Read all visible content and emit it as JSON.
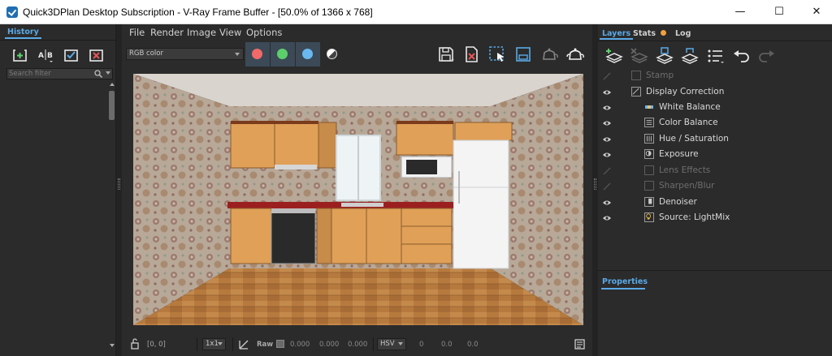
{
  "window": {
    "title": "Quick3DPlan Desktop Subscription - V-Ray Frame Buffer - [50.0% of 1366 x 768]",
    "minimize_label": "—",
    "maximize_label": "☐",
    "close_label": "✕"
  },
  "history": {
    "tab_label": "History",
    "search_placeholder": "Search filter",
    "buttons": [
      "save-to-history",
      "ab-compare",
      "load-history",
      "remove-history"
    ]
  },
  "menu": {
    "items": [
      "File",
      "Render",
      "Image",
      "View",
      "Options"
    ]
  },
  "toolbar": {
    "channel": "RGB color",
    "channel_colors": {
      "red": "#f06a6a",
      "green": "#5ccf6a",
      "blue": "#6ab8f0"
    },
    "icons": [
      "save-image-icon",
      "clear-image-icon",
      "region-render-icon",
      "track-mouse-icon",
      "render-last-icon",
      "render-icon"
    ]
  },
  "status": {
    "coords": "[0, 0]",
    "zoom_mode": "1x1",
    "raw_label": "Raw",
    "r": "0.000",
    "g": "0.000",
    "b": "0.000",
    "color_space": "HSV",
    "h": "0",
    "s": "0.0",
    "v": "0.0"
  },
  "right_panel": {
    "tabs": {
      "layers": "Layers",
      "stats": "Stats",
      "log": "Log"
    },
    "icons": [
      "add-layer-icon",
      "delete-layer-icon",
      "save-layers-icon",
      "load-layers-icon",
      "layer-presets-icon",
      "undo-icon",
      "redo-icon"
    ],
    "layers": [
      {
        "label": "Stamp",
        "enabled": false,
        "indent": 0
      },
      {
        "label": "Display Correction",
        "enabled": true,
        "indent": 0
      },
      {
        "label": "White Balance",
        "enabled": true,
        "indent": 1
      },
      {
        "label": "Color Balance",
        "enabled": true,
        "indent": 1
      },
      {
        "label": "Hue / Saturation",
        "enabled": true,
        "indent": 1
      },
      {
        "label": "Exposure",
        "enabled": true,
        "indent": 1
      },
      {
        "label": "Lens Effects",
        "enabled": false,
        "indent": 1
      },
      {
        "label": "Sharpen/Blur",
        "enabled": false,
        "indent": 1
      },
      {
        "label": "Denoiser",
        "enabled": true,
        "indent": 1
      },
      {
        "label": "Source: LightMix",
        "enabled": true,
        "indent": 1
      }
    ],
    "properties_label": "Properties"
  }
}
